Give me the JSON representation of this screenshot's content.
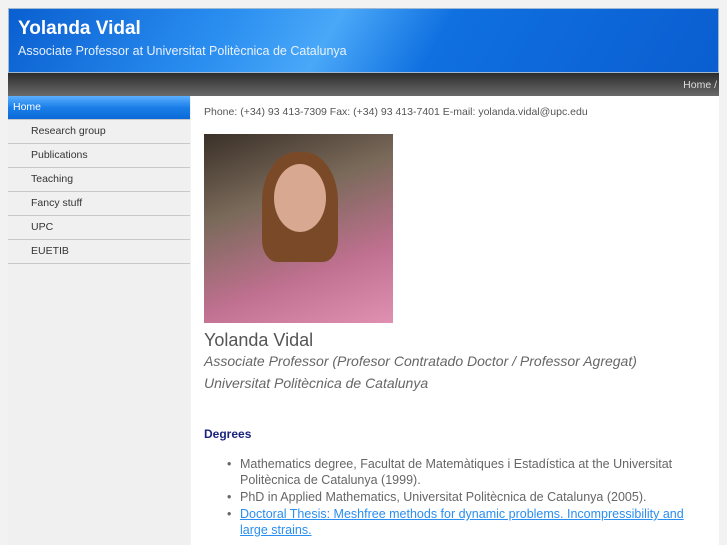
{
  "header": {
    "title": "Yolanda Vidal",
    "subtitle": "Associate Professor at Universitat Politècnica de Catalunya"
  },
  "breadcrumb": "Home /",
  "sidebar": {
    "items": [
      {
        "label": "Home"
      },
      {
        "label": "Research group"
      },
      {
        "label": "Publications"
      },
      {
        "label": "Teaching"
      },
      {
        "label": "Fancy stuff"
      },
      {
        "label": "UPC"
      },
      {
        "label": "EUETIB"
      }
    ]
  },
  "main": {
    "contact": "Phone: (+34) 93 413-7309 Fax: (+34) 93 413-7401 E-mail: yolanda.vidal@upc.edu",
    "name": "Yolanda Vidal",
    "position": "Associate Professor (Profesor Contratado Doctor / Professor Agregat)",
    "institution": "Universitat Politècnica de Catalunya",
    "degrees_heading": "Degrees",
    "degrees": [
      "Mathematics degree, Facultat de Matemàtiques i Estadística at the Universitat Politècnica de Catalunya (1999).",
      "PhD in Applied Mathematics, Universitat Politècnica de Catalunya (2005).",
      "Doctoral Thesis: Meshfree methods for dynamic problems. Incompressibility and large strains."
    ]
  }
}
